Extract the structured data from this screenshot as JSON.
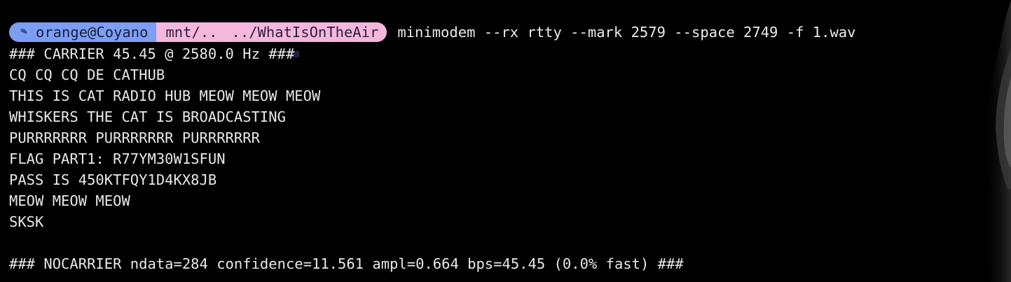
{
  "prompt": {
    "user": "orange@Coyano",
    "path_prefix": "mnt/..",
    "path_suffix": "../WhatIsOnTheAir",
    "command": "minimodem --rx rtty --mark 2579 --space 2749 -f 1.wav",
    "icons": [
      "os-logo-icon",
      "folder-icon"
    ],
    "colors": {
      "user_bg": "#7d9ef5",
      "path_bg": "#f5b7dd"
    }
  },
  "output": {
    "lines": [
      "### CARRIER 45.45 @ 2580.0 Hz ###",
      "CQ CQ CQ DE CATHUB",
      "THIS IS CAT RADIO HUB MEOW MEOW MEOW",
      "WHISKERS THE CAT IS BROADCASTING",
      "PURRRRRRR PURRRRRRR PURRRRRRR",
      "FLAG PART1: R77YM30W1SFUN",
      "PASS IS 450KTFQY1D4KX8JB",
      "MEOW MEOW MEOW",
      "SKSK",
      "",
      "### NOCARRIER ndata=284 confidence=11.561 ampl=0.664 bps=45.45 (0.0% fast) ###"
    ]
  }
}
